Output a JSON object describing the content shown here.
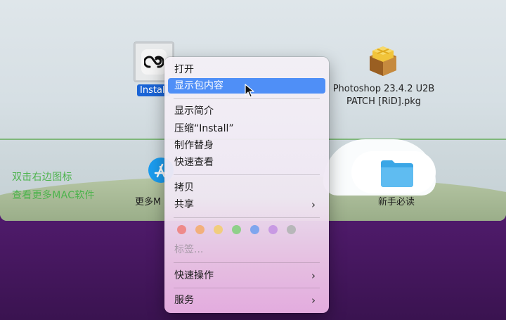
{
  "window": {
    "promo_line1": "双击右边图标",
    "promo_line2": "查看更多MAC软件",
    "files": {
      "install_label": "Install",
      "photoshop_label_line1": "Photoshop 23.4.2 U2B",
      "photoshop_label_line2": "PATCH [RiD].pkg",
      "more_apps_label": "更多M",
      "readme_label": "新手必读"
    }
  },
  "context_menu": {
    "open": "打开",
    "show_contents": "显示包内容",
    "get_info": "显示简介",
    "compress": "压缩“Install”",
    "make_alias": "制作替身",
    "quick_look": "快速查看",
    "copy": "拷贝",
    "share": "共享",
    "tags_label": "标签...",
    "quick_actions": "快速操作",
    "services": "服务",
    "tag_colors": [
      "#ee8a8a",
      "#f2b07c",
      "#f1cd7e",
      "#8fd08a",
      "#7fa6ee",
      "#c89ae3",
      "#b7b7b9"
    ]
  },
  "icons": {
    "creative_cloud": "creative-cloud-icon",
    "package": "package-icon",
    "app_store": "app-store-icon",
    "folder": "folder-icon",
    "cursor": "cursor-icon"
  }
}
